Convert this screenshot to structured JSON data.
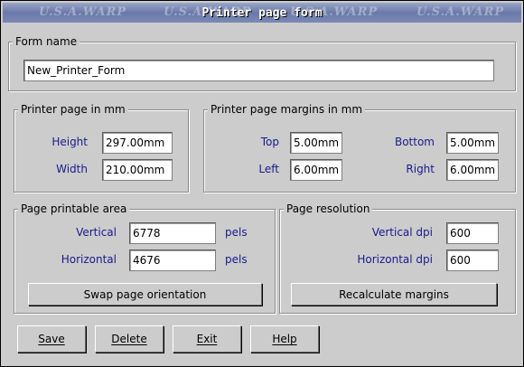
{
  "window": {
    "title": "Printer page form",
    "watermark": [
      "U.S.A.WARP",
      "U.S.A.WARP",
      "U.S.A.WARP",
      "U.S.A.WARP"
    ]
  },
  "form_name": {
    "legend": "Form name",
    "value": "New_Printer_Form"
  },
  "page_size": {
    "legend": "Printer page in mm",
    "height_label": "Height",
    "height_value": "297.00mm",
    "width_label": "Width",
    "width_value": "210.00mm"
  },
  "margins": {
    "legend": "Printer page margins in mm",
    "top_label": "Top",
    "top_value": "5.00mm",
    "bottom_label": "Bottom",
    "bottom_value": "5.00mm",
    "left_label": "Left",
    "left_value": "6.00mm",
    "right_label": "Right",
    "right_value": "6.00mm"
  },
  "printable_area": {
    "legend": "Page printable area",
    "vertical_label": "Vertical",
    "vertical_value": "6778",
    "horizontal_label": "Horizontal",
    "horizontal_value": "4676",
    "unit": "pels",
    "swap_button": "Swap page orientation"
  },
  "resolution": {
    "legend": "Page resolution",
    "vertical_label": "Vertical dpi",
    "vertical_value": "600",
    "horizontal_label": "Horizontal dpi",
    "horizontal_value": "600",
    "recalc_button": "Recalculate margins"
  },
  "buttons": {
    "save": "Save",
    "delete": "Delete",
    "exit": "Exit",
    "help": "Help"
  }
}
